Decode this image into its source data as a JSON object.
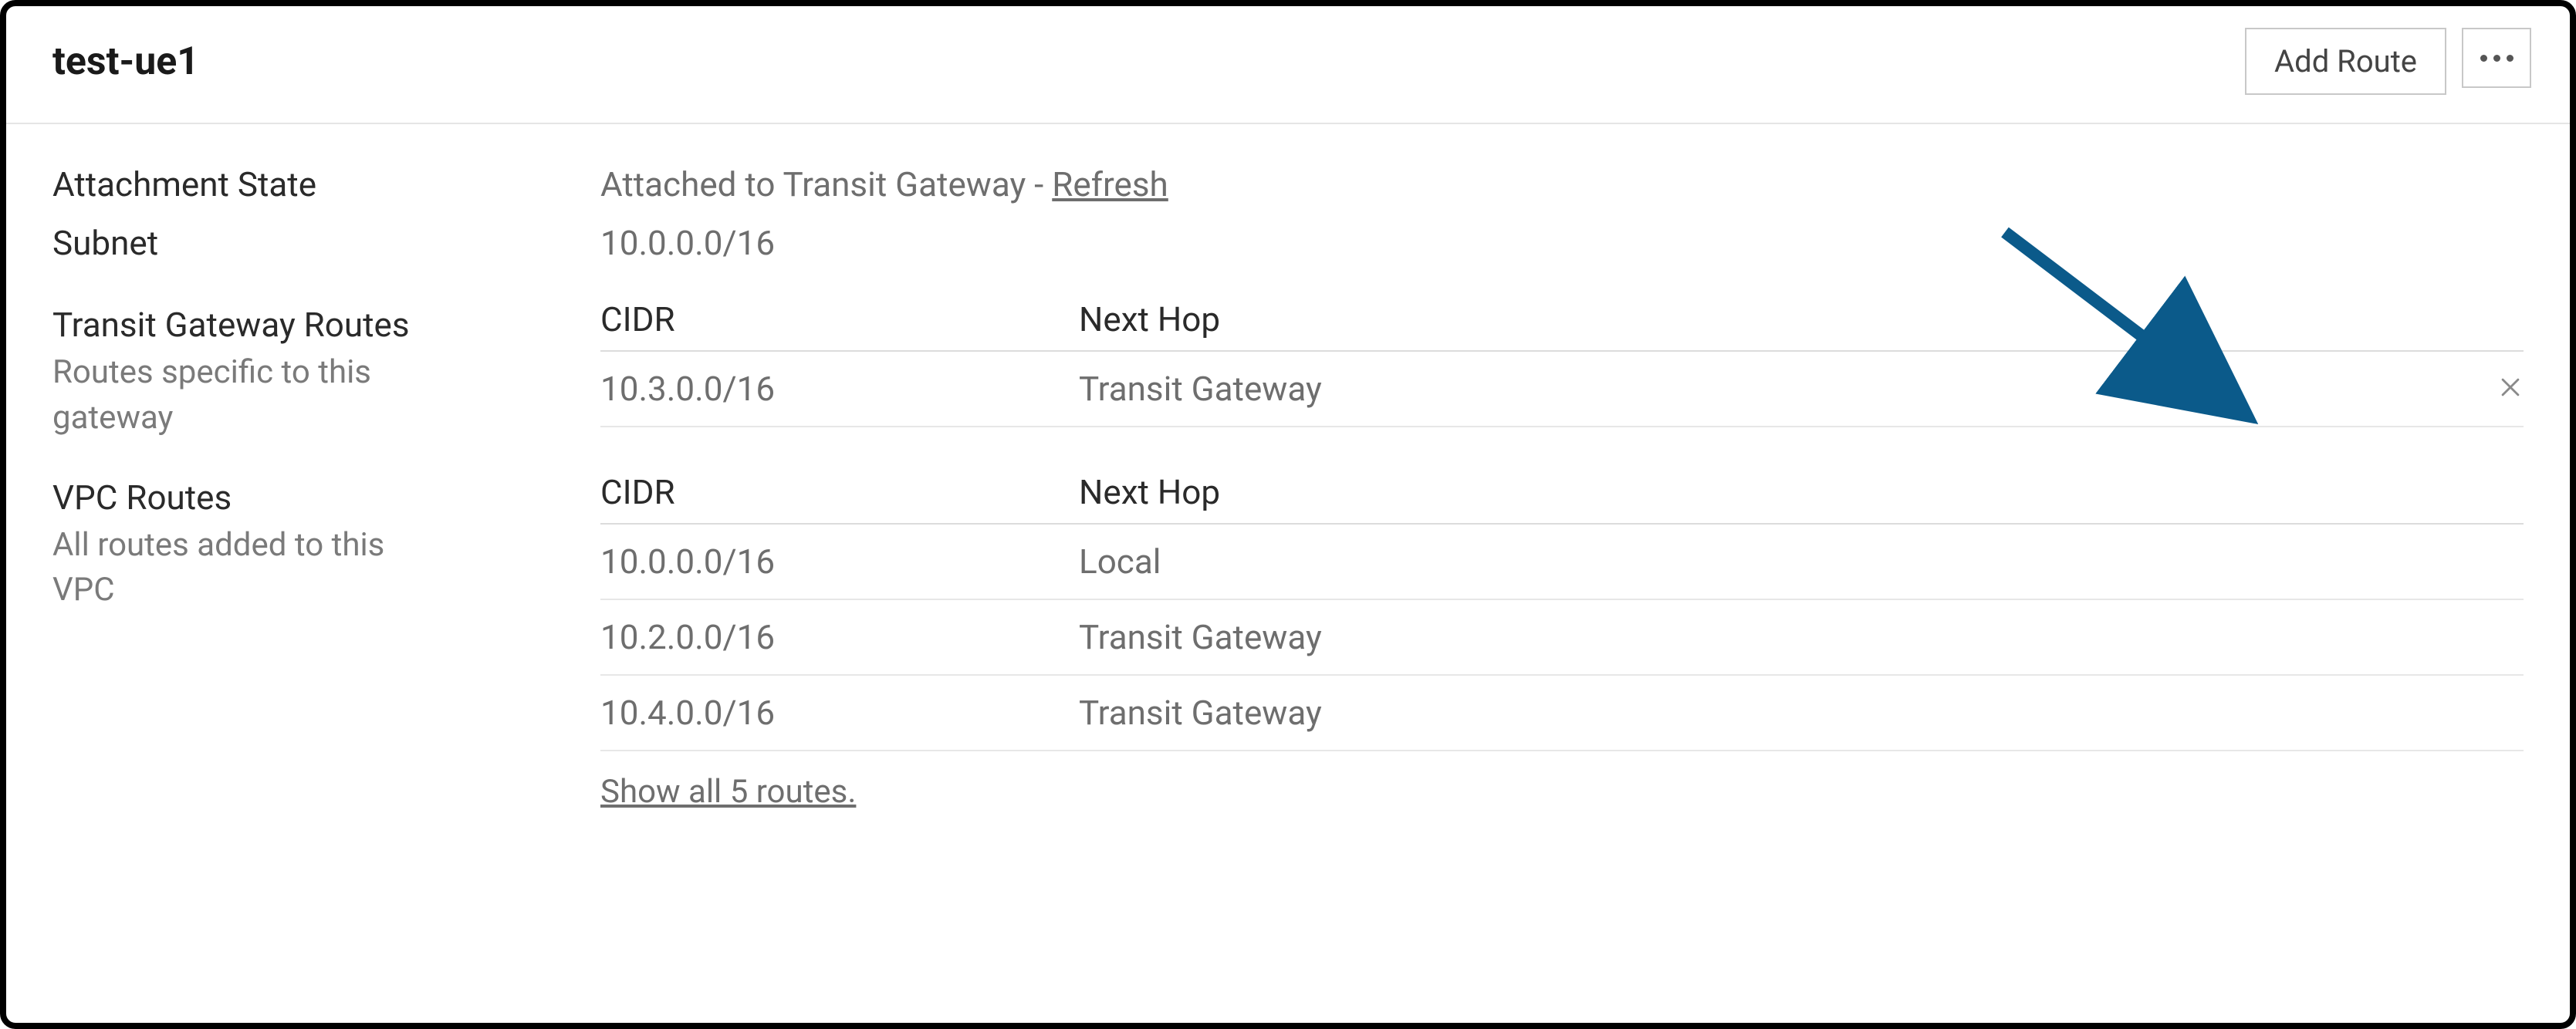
{
  "header": {
    "title": "test-ue1",
    "add_route_label": "Add Route"
  },
  "attachment": {
    "label": "Attachment State",
    "value": "Attached to Transit Gateway - ",
    "refresh_label": "Refresh"
  },
  "subnet": {
    "label": "Subnet",
    "value": "10.0.0.0/16"
  },
  "tgw_routes": {
    "label": "Transit Gateway Routes",
    "sub": "Routes specific to this gateway",
    "headers": {
      "cidr": "CIDR",
      "next_hop": "Next Hop"
    },
    "rows": [
      {
        "cidr": "10.3.0.0/16",
        "next_hop": "Transit Gateway"
      }
    ]
  },
  "vpc_routes": {
    "label": "VPC Routes",
    "sub": "All routes added to this VPC",
    "headers": {
      "cidr": "CIDR",
      "next_hop": "Next Hop"
    },
    "rows": [
      {
        "cidr": "10.0.0.0/16",
        "next_hop": "Local"
      },
      {
        "cidr": "10.2.0.0/16",
        "next_hop": "Transit Gateway"
      },
      {
        "cidr": "10.4.0.0/16",
        "next_hop": "Transit Gateway"
      }
    ],
    "show_all_label": "Show all 5 routes."
  },
  "annotation": {
    "arrow_color": "#0b5a8a"
  }
}
